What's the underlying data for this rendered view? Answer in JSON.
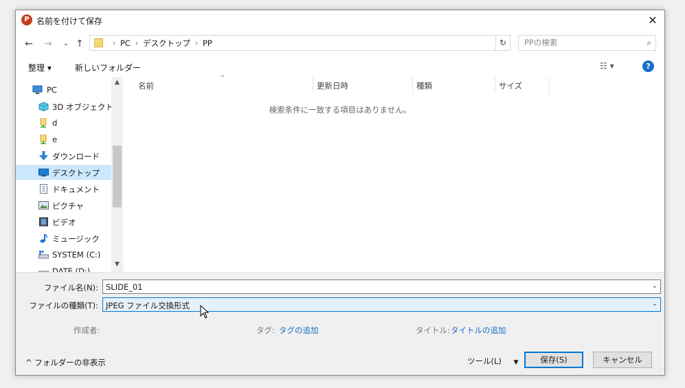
{
  "window": {
    "title": "名前を付けて保存",
    "app_icon": "P",
    "close_glyph": "✕"
  },
  "nav": {
    "back": "←",
    "forward": "→",
    "history": "⌄",
    "up": "↑"
  },
  "address": {
    "crumbs": [
      "PC",
      "デスクトップ",
      "PP"
    ],
    "separator": "›",
    "dropdown": "⌄",
    "refresh": "↻"
  },
  "search": {
    "placeholder": "PPの検索",
    "icon": "⌕"
  },
  "toolbar": {
    "organize": "整理 ▾",
    "new_folder": "新しいフォルダー",
    "view": "☷ ▾",
    "help": "?"
  },
  "sidebar": {
    "items": [
      {
        "label": "PC",
        "icon": "pc-icon"
      },
      {
        "label": "3D オブジェクト",
        "icon": "cube-icon"
      },
      {
        "label": "d",
        "icon": "drive-icon"
      },
      {
        "label": "e",
        "icon": "drive-icon"
      },
      {
        "label": "ダウンロード",
        "icon": "download-icon"
      },
      {
        "label": "デスクトップ",
        "icon": "desktop-icon",
        "selected": true
      },
      {
        "label": "ドキュメント",
        "icon": "document-icon"
      },
      {
        "label": "ピクチャ",
        "icon": "picture-icon"
      },
      {
        "label": "ビデオ",
        "icon": "video-icon"
      },
      {
        "label": "ミュージック",
        "icon": "music-icon"
      },
      {
        "label": "SYSTEM (C:)",
        "icon": "system-drive-icon"
      },
      {
        "label": "DATE (D:)",
        "icon": "data-drive-icon"
      }
    ]
  },
  "filelist": {
    "columns": [
      "名前",
      "更新日時",
      "種類",
      "サイズ"
    ],
    "empty_message": "検索条件に一致する項目はありません。"
  },
  "form": {
    "filename_label": "ファイル名(N):",
    "filename_value": "SLIDE_01",
    "filetype_label": "ファイルの種類(T):",
    "filetype_value": "JPEG ファイル交換形式",
    "author_label": "作成者:",
    "tags_label": "タグ:",
    "tags_link": "タグの追加",
    "title_label": "タイトル:",
    "title_link": "タイトルの追加"
  },
  "footer": {
    "hide_folders": "フォルダーの非表示",
    "tools": "ツール(L)",
    "save": "保存(S)",
    "cancel": "キャンセル"
  },
  "colors": {
    "accent": "#0078d7",
    "selection": "#cce8ff",
    "link": "#1a6fc9"
  }
}
